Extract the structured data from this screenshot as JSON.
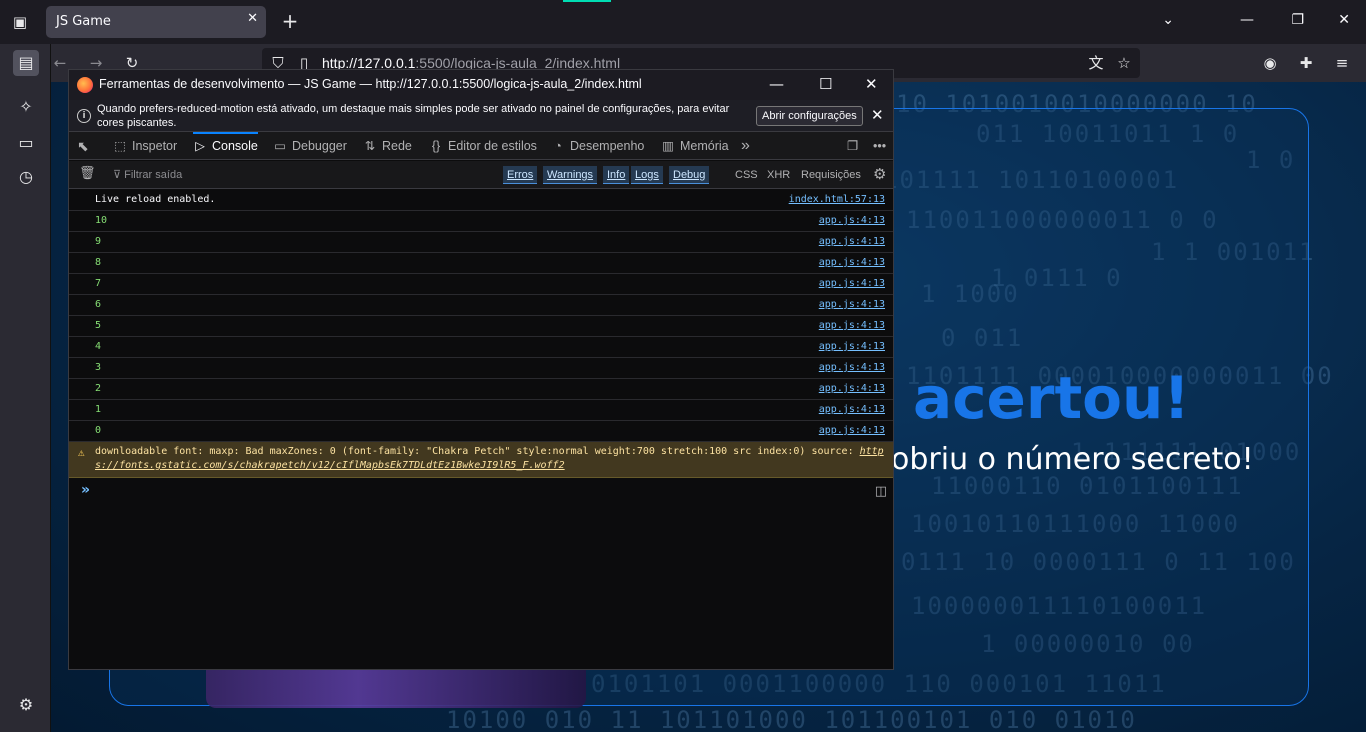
{
  "browser": {
    "tab_title": "JS Game",
    "tab_close": "✕",
    "new_tab": "+",
    "url_host": "http://127.0.0.1",
    "url_rest": ":5500/logica-js-aula_2/index.html"
  },
  "game": {
    "title": "acertou!",
    "subtitle": "obriu o número secreto!",
    "binary_rows": [
      "10 1010010010000000 10",
      "011 10011011 1 0",
      "1 0",
      "101111 10110100001",
      "110011000000011 0 0",
      "1 1 001011",
      "1 0111 0",
      "1 1000",
      "0 011",
      "1101111 000010000000011 00",
      "1 111111 01000",
      "11000110 0101100111",
      "10010110111000 11000",
      "0111 10 0000111 0 11 100",
      "100000011110100011",
      "1 00000010 00",
      "0101101 0001100000 110 000101 11011",
      "10100 010 11 101101000 101100101 010 01010"
    ]
  },
  "devtools": {
    "title": "Ferramentas de desenvolvimento — JS Game — http://127.0.0.1:5500/logica-js-aula_2/index.html",
    "notice": "Quando prefers-reduced-motion está ativado, um destaque mais simples pode ser ativado no painel de configurações, para evitar cores piscantes.",
    "notice_button": "Abrir configurações",
    "tabs": [
      {
        "icon": "⬚",
        "label": "Inspetor"
      },
      {
        "icon": "▷",
        "label": "Console"
      },
      {
        "icon": "▭",
        "label": "Debugger"
      },
      {
        "icon": "⇅",
        "label": "Rede"
      },
      {
        "icon": "{}",
        "label": "Editor de estilos"
      },
      {
        "icon": "◔",
        "label": "Desempenho"
      },
      {
        "icon": "▥",
        "label": "Memória"
      }
    ],
    "more_tabs": "»",
    "filter_placeholder": "Filtrar saída",
    "levels": [
      "Erros",
      "Warnings",
      "Info",
      "Logs",
      "Debug"
    ],
    "extras": [
      "CSS",
      "XHR",
      "Requisições"
    ],
    "first_log": {
      "msg": "Live reload enabled.",
      "src": "index.html:57:13"
    },
    "count_logs": [
      {
        "msg": "10",
        "src": "app.js:4:13"
      },
      {
        "msg": "9",
        "src": "app.js:4:13"
      },
      {
        "msg": "8",
        "src": "app.js:4:13"
      },
      {
        "msg": "7",
        "src": "app.js:4:13"
      },
      {
        "msg": "6",
        "src": "app.js:4:13"
      },
      {
        "msg": "5",
        "src": "app.js:4:13"
      },
      {
        "msg": "4",
        "src": "app.js:4:13"
      },
      {
        "msg": "3",
        "src": "app.js:4:13"
      },
      {
        "msg": "2",
        "src": "app.js:4:13"
      },
      {
        "msg": "1",
        "src": "app.js:4:13"
      },
      {
        "msg": "0",
        "src": "app.js:4:13"
      }
    ],
    "warning_text": "downloadable font: maxp: Bad maxZones: 0 (font-family: \"Chakra Petch\" style:normal weight:700 stretch:100 src index:0) source: ",
    "warning_link": "https://fonts.gstatic.com/s/chakrapetch/v12/cIflMapbsEk7TDLdtEz1BwkeJI9lR5_F.woff2"
  }
}
